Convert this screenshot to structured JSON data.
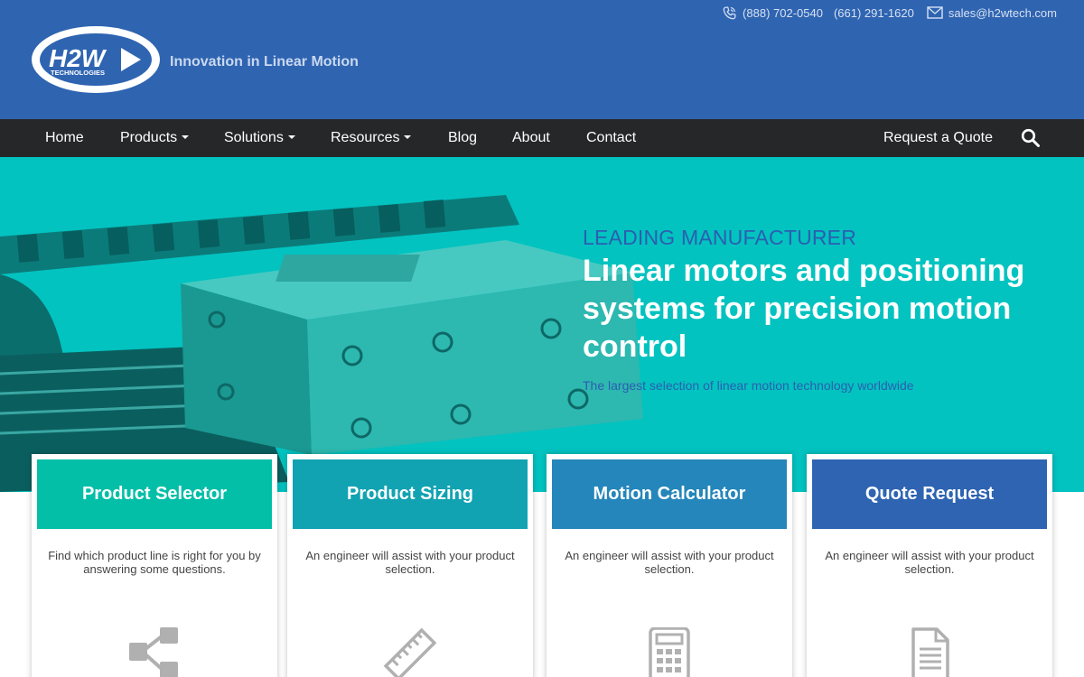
{
  "header": {
    "logo_text": "H2W",
    "logo_subtext": "TECHNOLOGIES",
    "tagline": "Innovation in Linear Motion",
    "phone_1": "(888) 702-0540",
    "phone_2": "(661) 291-1620",
    "email": "sales@h2wtech.com",
    "icons": {
      "phone": "phone-icon",
      "mail": "mail-icon",
      "search": "search-icon"
    }
  },
  "nav": {
    "items": [
      {
        "label": "Home",
        "dropdown": false
      },
      {
        "label": "Products",
        "dropdown": true
      },
      {
        "label": "Solutions",
        "dropdown": true
      },
      {
        "label": "Resources",
        "dropdown": true
      },
      {
        "label": "Blog",
        "dropdown": false
      },
      {
        "label": "About",
        "dropdown": false
      },
      {
        "label": "Contact",
        "dropdown": false
      }
    ],
    "quote": "Request a Quote"
  },
  "hero": {
    "eyebrow": "LEADING MANUFACTURER",
    "title": "Linear motors and positioning systems for precision motion control",
    "subtitle": "The largest selection of linear motion technology worldwide"
  },
  "cards": [
    {
      "title": "Product Selector",
      "description": "Find which product line is right for you by answering some questions.",
      "color": "#03bfa8",
      "icon": "share-icon"
    },
    {
      "title": "Product Sizing",
      "description": "An engineer will assist with your product selection.",
      "color": "#11a3b2",
      "icon": "ruler-icon"
    },
    {
      "title": "Motion Calculator",
      "description": "An engineer will assist with your product selection.",
      "color": "#2486ba",
      "icon": "calculator-icon"
    },
    {
      "title": "Quote Request",
      "description": "An engineer will assist with your product selection.",
      "color": "#2e64b2",
      "icon": "document-icon"
    }
  ],
  "colors": {
    "header_bg": "#2f64b1",
    "nav_bg": "#262729",
    "hero_bg": "#02c3c0",
    "accent_blue": "#2b5fb0"
  }
}
